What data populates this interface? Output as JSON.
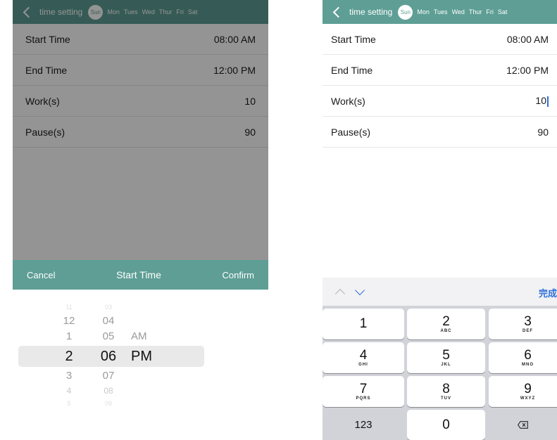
{
  "nav": {
    "back_icon": "chevron-left-icon",
    "title": "time setting",
    "days": [
      "Sun",
      "Mon",
      "Tues",
      "Wed",
      "Thur",
      "Fri",
      "Sat"
    ],
    "selected_day": "Sun"
  },
  "settings": [
    {
      "label": "Start Time",
      "value": "08:00 AM"
    },
    {
      "label": "End Time",
      "value": "12:00 PM"
    },
    {
      "label": "Work(s)",
      "value": "10"
    },
    {
      "label": "Pause(s)",
      "value": "90"
    }
  ],
  "picker": {
    "cancel_label": "Cancel",
    "title": "Start Time",
    "confirm_label": "Confirm",
    "hours": [
      "11",
      "12",
      "1",
      "2",
      "3",
      "4",
      "5"
    ],
    "minutes": [
      "03",
      "04",
      "05",
      "06",
      "07",
      "08",
      "09"
    ],
    "ampm": [
      "AM",
      "PM"
    ],
    "selected_hour": "2",
    "selected_minute": "06",
    "selected_ampm": "PM"
  },
  "keyboard": {
    "prev_icon": "chevron-up-icon",
    "next_icon": "chevron-down-icon",
    "done_label": "完成",
    "keys": [
      {
        "digit": "1",
        "letters": ""
      },
      {
        "digit": "2",
        "letters": "ABC"
      },
      {
        "digit": "3",
        "letters": "DEF"
      },
      {
        "digit": "4",
        "letters": "GHI"
      },
      {
        "digit": "5",
        "letters": "JKL"
      },
      {
        "digit": "6",
        "letters": "MNO"
      },
      {
        "digit": "7",
        "letters": "PQRS"
      },
      {
        "digit": "8",
        "letters": "TUV"
      },
      {
        "digit": "9",
        "letters": "WXYZ"
      }
    ],
    "mode_label": "123",
    "zero": "0",
    "delete_icon": "backspace-icon"
  },
  "colors": {
    "accent": "#5e9e95",
    "selection_bg": "#e9e9e9",
    "caret": "#2f6fd6"
  }
}
